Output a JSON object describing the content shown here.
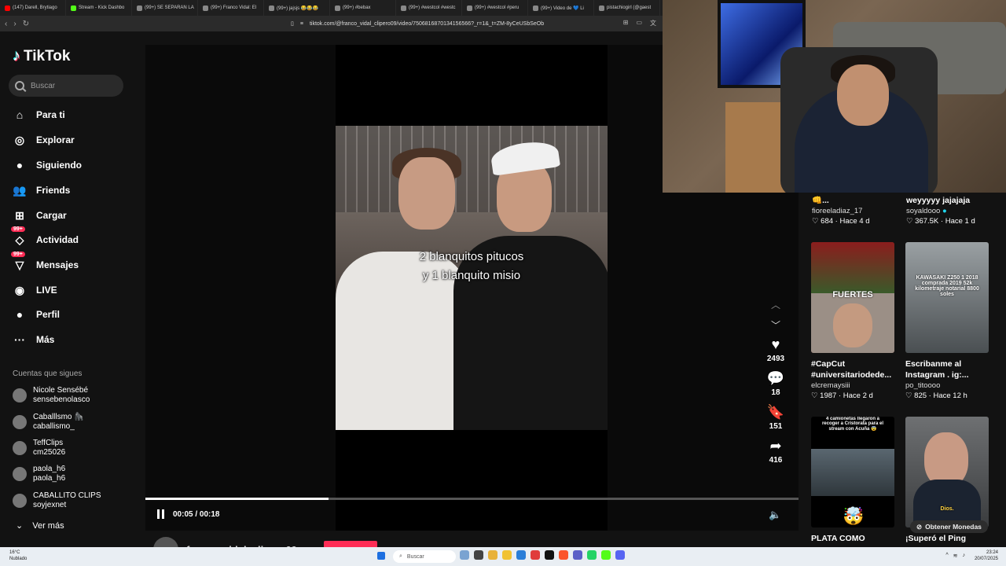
{
  "browser": {
    "tabs": [
      {
        "label": "(147) Darell, Brytiago",
        "color": "#ff0000"
      },
      {
        "label": "Stream - Kick Dashbo",
        "color": "#53fc18"
      },
      {
        "label": "(99+) SE SEPARAN LA",
        "color": "#888888"
      },
      {
        "label": "(99+) Franco Vidal: El",
        "color": "#888888"
      },
      {
        "label": "(99+) jajsjs 😂😂😂",
        "color": "#888888"
      },
      {
        "label": "(99+) #bebax",
        "color": "#888888"
      },
      {
        "label": "(99+) #westcol #westc",
        "color": "#888888"
      },
      {
        "label": "(99+) #westcol #peru",
        "color": "#888888"
      },
      {
        "label": "(99+) Video de 💙 Li",
        "color": "#888888"
      },
      {
        "label": "pistachiogirl (@gaest",
        "color": "#888888"
      }
    ],
    "url": "tiktok.com/@franco_vidal_clipero09/video/7506816870134156566?_r=1&_t=ZM-8yCeUSbSeOb"
  },
  "sidebar": {
    "logo": "TikTok",
    "search_placeholder": "Buscar",
    "items": [
      {
        "label": "Para ti",
        "icon": "home-icon",
        "glyph": "⌂"
      },
      {
        "label": "Explorar",
        "icon": "compass-icon",
        "glyph": "◎"
      },
      {
        "label": "Siguiendo",
        "icon": "following-avatar-icon",
        "glyph": "●"
      },
      {
        "label": "Friends",
        "icon": "friends-icon",
        "glyph": "👥"
      },
      {
        "label": "Cargar",
        "icon": "upload-icon",
        "glyph": "⊞"
      },
      {
        "label": "Actividad",
        "icon": "activity-icon",
        "glyph": "◇",
        "badge": "99+"
      },
      {
        "label": "Mensajes",
        "icon": "messages-icon",
        "glyph": "▽",
        "badge": "99+"
      },
      {
        "label": "LIVE",
        "icon": "live-icon",
        "glyph": "◉"
      },
      {
        "label": "Perfil",
        "icon": "profile-icon",
        "glyph": "●"
      },
      {
        "label": "Más",
        "icon": "more-icon",
        "glyph": "···"
      }
    ],
    "following_title": "Cuentas que sigues",
    "following": [
      {
        "name": "Nicole Sensébé",
        "handle": "sensebenolasco"
      },
      {
        "name": "Caballlsmo 🦍",
        "handle": "caballismo_"
      },
      {
        "name": "TeffClips",
        "handle": "cm25026"
      },
      {
        "name": "paola_h6",
        "handle": "paola_h6"
      },
      {
        "name": "CABALLITO CLIPS",
        "handle": "soyjexnet"
      }
    ],
    "see_more": "Ver más"
  },
  "video": {
    "caption_line1": "2 blanquitos pitucos",
    "caption_line2": "y 1 blanquito misio",
    "time": "00:05 / 00:18",
    "progress": 0.28,
    "likes": "2493",
    "comments": "18",
    "saves": "151",
    "shares": "416",
    "author": "franco_vidal_clipero09"
  },
  "feed": [
    {
      "title": "👊...",
      "user": "fioreeladiaz_17",
      "likes": "684",
      "age": "Hace 4 d"
    },
    {
      "title": "weyyyyy jajajaja",
      "user": "soyaldooo",
      "likes": "367.5K",
      "age": "Hace 1 d"
    },
    {
      "title": "#CapCut #universitariodede...",
      "user": "elcremaysiii",
      "likes": "1987",
      "age": "Hace 2 d",
      "thumb_text": "FUERTES"
    },
    {
      "title": "Escribanme al Instagram . ig:...",
      "user": "po_titoooo",
      "likes": "825",
      "age": "Hace 12 h",
      "thumb_text": "KAWASAKI Z250 1 2018 comprada 2019 52k kilometraje notarial 8800 soles"
    },
    {
      "title": "PLATA COMO",
      "thumb_text": "4 camionetas llegaron a recoger a Cristorata para el stream con Acuña 😨"
    },
    {
      "title": "¡Superó el Ping",
      "thumb_text": "Dios."
    }
  ],
  "coins_label": "Obtener Monedas",
  "taskbar": {
    "weather_temp": "16°C",
    "weather_desc": "Nublado",
    "search": "Buscar",
    "time": "23:24",
    "date": "20/07/2025"
  }
}
